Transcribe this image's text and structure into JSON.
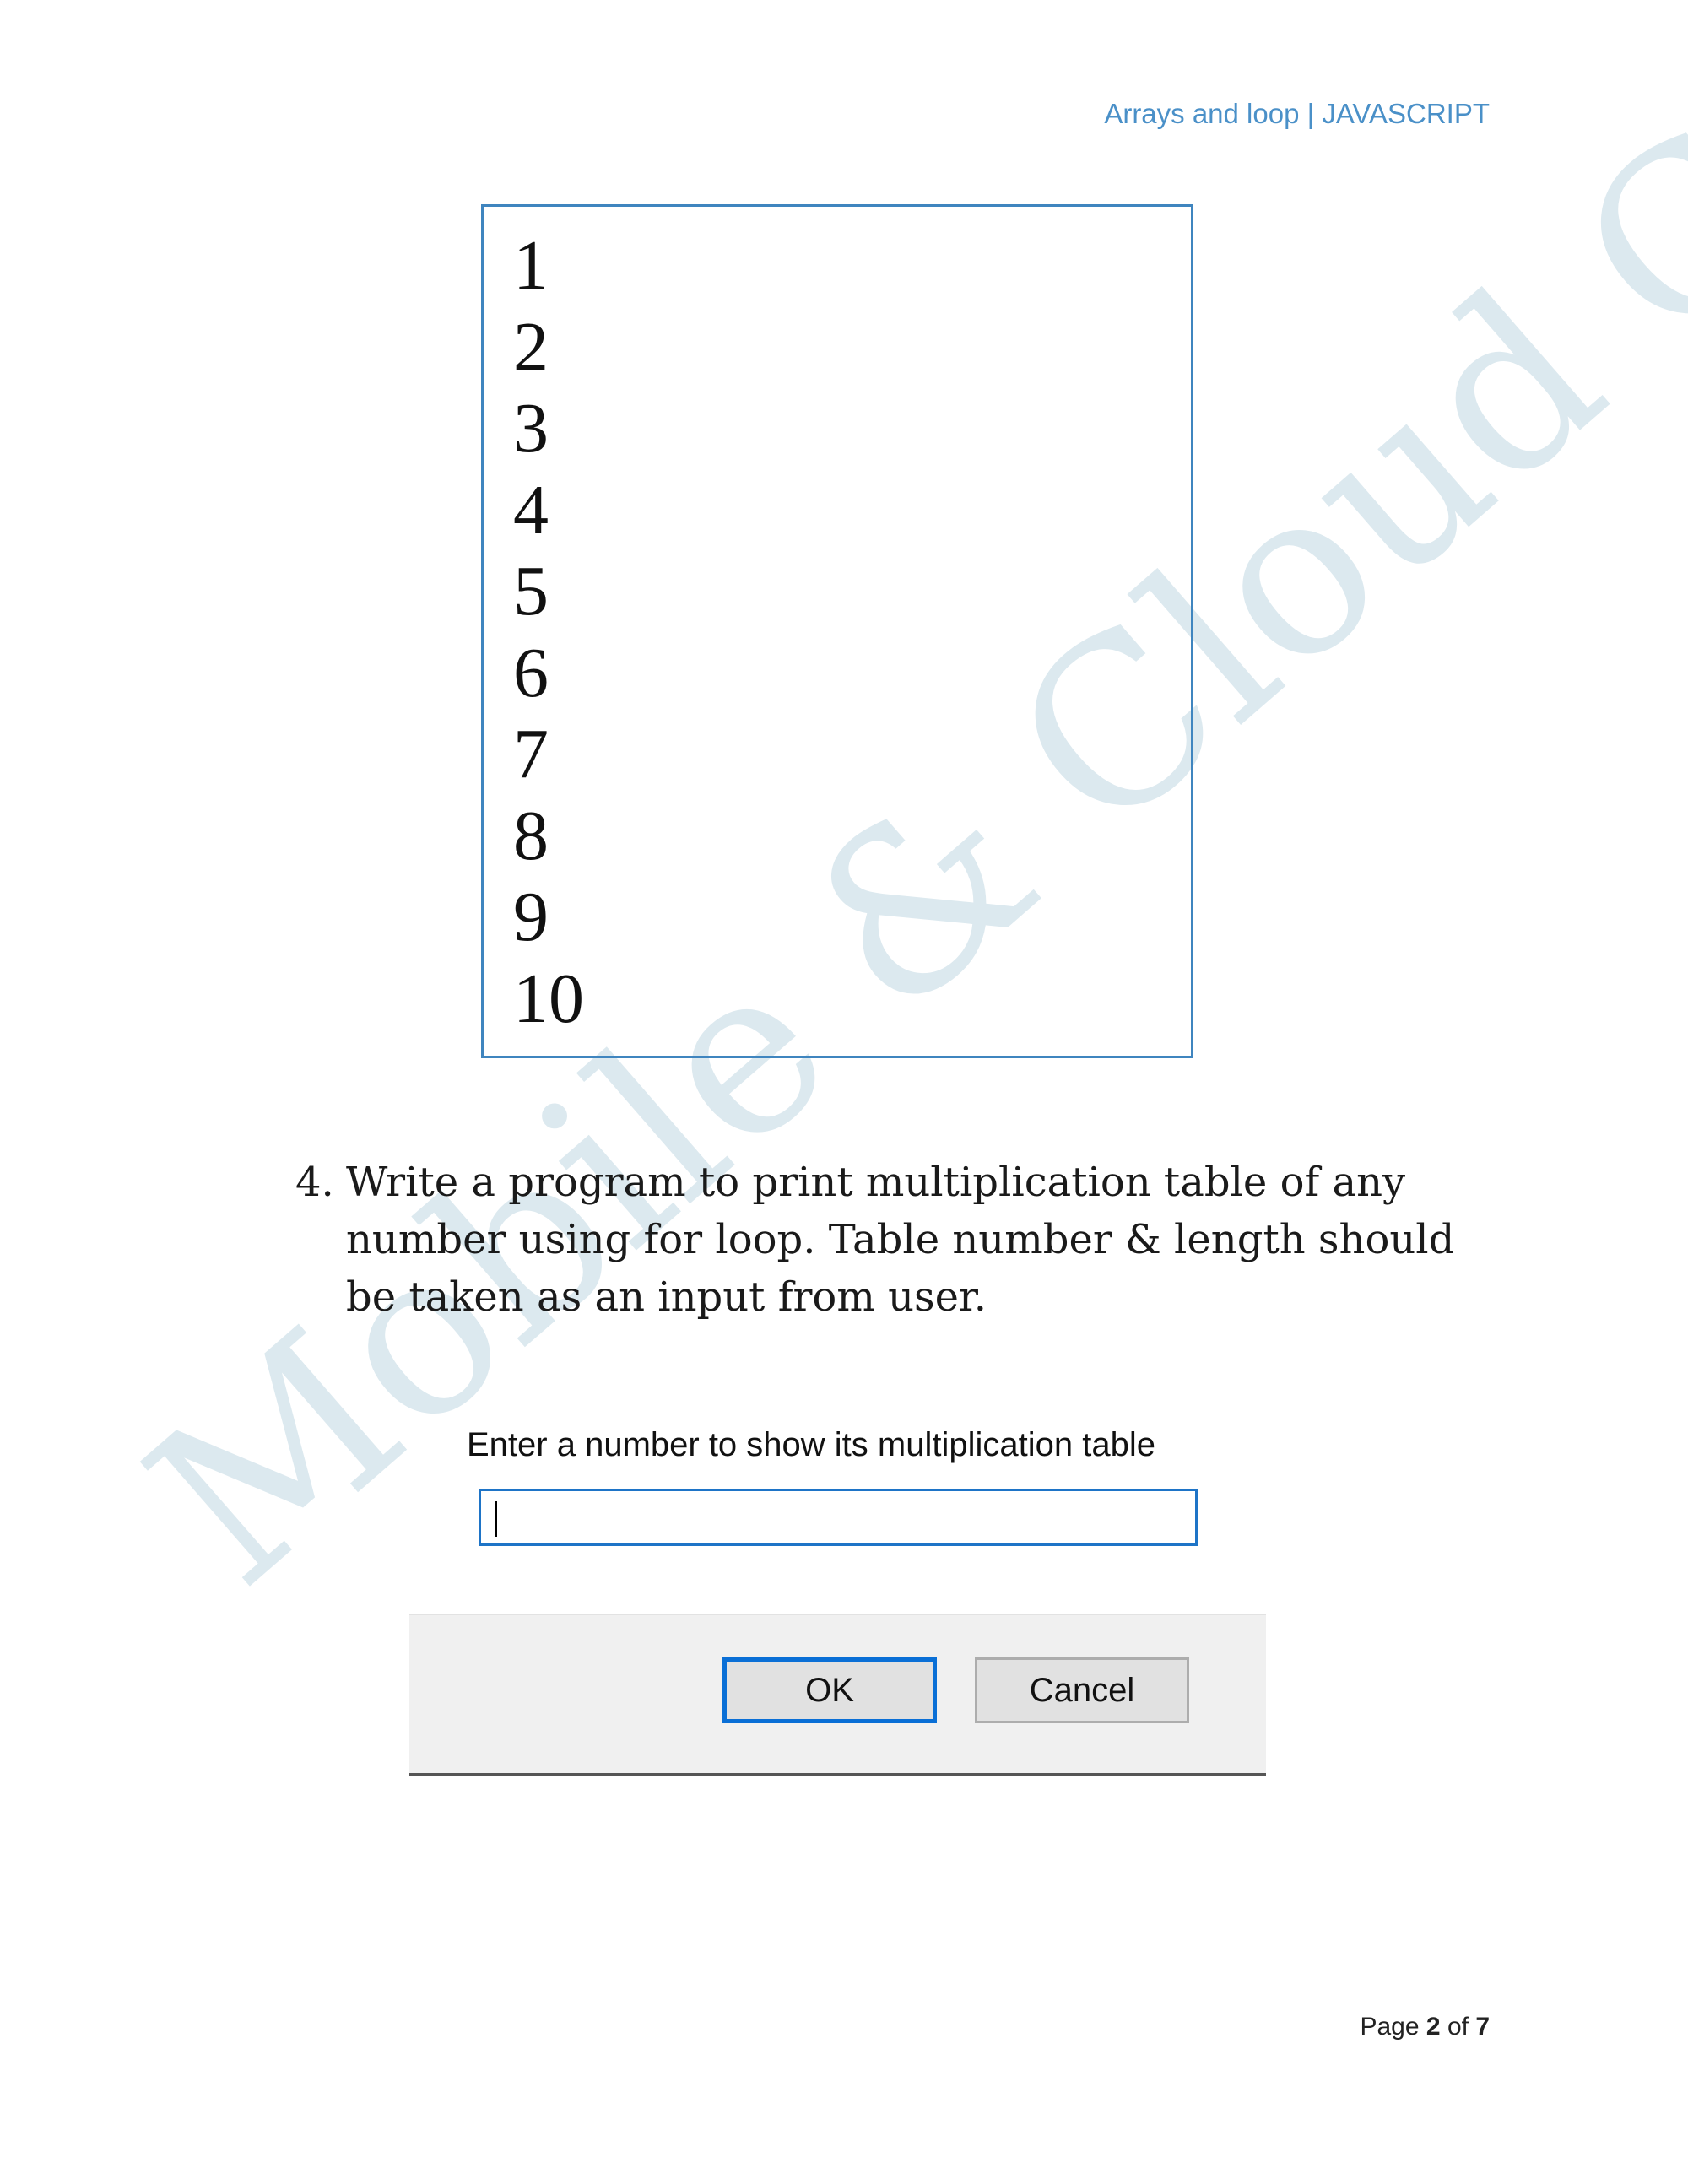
{
  "header": {
    "title": "Arrays and loop | JAVASCRIPT"
  },
  "watermark": {
    "text": "Mobile & Cloud Computing"
  },
  "output": {
    "numbers": [
      "1",
      "2",
      "3",
      "4",
      "5",
      "6",
      "7",
      "8",
      "9",
      "10"
    ]
  },
  "question": {
    "number": "4.",
    "text": "Write a program to print multiplication table of any number using for loop. Table number & length should be taken as an input from user."
  },
  "prompt_dialog": {
    "label": "Enter a number to show its multiplication table",
    "input_value": "",
    "ok_label": "OK",
    "cancel_label": "Cancel"
  },
  "footer": {
    "page_word": "Page",
    "current": "2",
    "of_word": "of",
    "total": "7"
  }
}
